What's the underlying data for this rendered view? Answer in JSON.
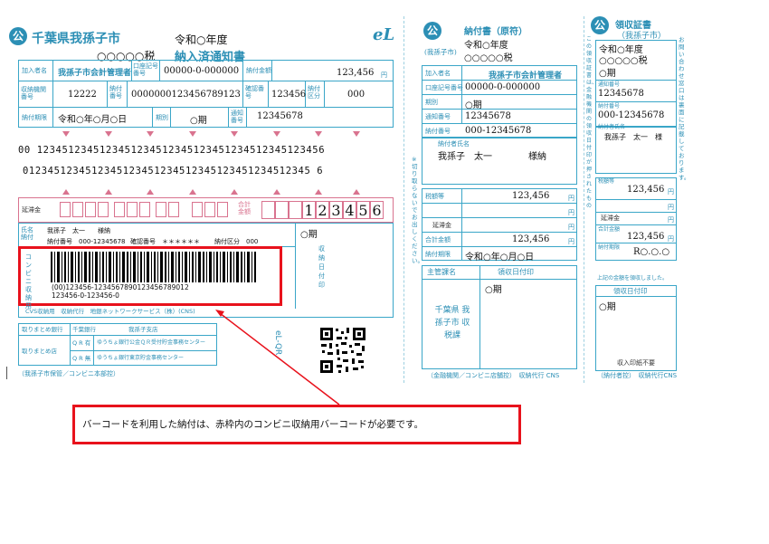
{
  "main": {
    "city": "千葉県我孫子市",
    "year": "令和○年度",
    "tax_name": "○○○○○税",
    "doc_title": "納入済通知書",
    "payer_label": "加入者名",
    "payer_value": "我孫子市会計管理者",
    "account_label": "口座記号番号",
    "account_value": "00000-0-000000",
    "amount_label": "納付金額",
    "amount_value": "123,456",
    "yen": "円",
    "inst_label": "収納機関番号",
    "inst_value": "12222",
    "notice_label": "納付番号",
    "notice_value": "0000000123456789123",
    "confirm_label": "確認番号",
    "confirm_value": "123456",
    "cls_label": "納付区分",
    "cls_value": "000",
    "due_label": "納付期限",
    "due_value": "令和○年○月○日",
    "period_label": "期別",
    "period_value": "○期",
    "notif_label": "通知番号",
    "notif_value": "12345678",
    "ocr_row1": "00 1234512345123451234512345123451234512345123456",
    "ocr_row2": "0123451234512345123451234512345123451234512345 6",
    "delay_label": "延滞金",
    "total_label": "合計金額",
    "total_digits": [
      "1",
      "2",
      "3",
      "4",
      "5",
      "6"
    ],
    "payer_small_label": "氏名納付",
    "payer_small_name": "我孫子　太一　　様納",
    "payer_small_notice": "納付番号　000-12345678",
    "payer_small_confirm": "確認番号　＊＊＊＊＊＊",
    "payer_small_cls": "納付区分　000",
    "period_right": "○期",
    "receipt_date_label": "収納日付印",
    "conv_label": "コンビニ収納用",
    "barcode_line1": "(00)123456-1234567890123456789012",
    "barcode_line2": "123456-0-123456-0",
    "cvs_label": "CVS収納用　収納代行　地銀ネットワークサービス（株）(CNS)",
    "bank_row1_label": "取りまとめ銀行",
    "bank_row1_a": "千葉銀行",
    "bank_row1_b": "我孫子支店",
    "bank_row2_label": "取りまとめ店",
    "bank_row2_a": "Q R 有",
    "bank_row2_b": "ゆうちょ銀行公金ＱＲ受付貯金事務センター",
    "bank_row3_a": "Q R 無",
    "bank_row3_b": "ゆうちょ銀行東京貯金事務センター",
    "eLQR": "eL-QR",
    "footer": "（我孫子市保管／コンビニ本部控）",
    "el_logo": "eL"
  },
  "middle": {
    "title": "納付書（原符）",
    "city": "(我孫子市)",
    "year": "令和○年度",
    "tax_name": "○○○○○税",
    "payer_label": "加入者名",
    "payer_value": "我孫子市会計管理者",
    "account_label": "口座記号番号",
    "account_value": "00000-0-000000",
    "period_label": "期別",
    "period_value": "○期",
    "notif_label": "通知番号",
    "notif_value": "12345678",
    "notice_label": "納付番号",
    "notice_value": "000-12345678",
    "name_label": "納付者氏名",
    "name_value": "我孫子　太一　　　　様納",
    "side_note": "※切り取らないでお出しください。",
    "tax_label": "税額等",
    "tax_value": "123,456",
    "delay_label": "延滞金",
    "total_label": "合計金額",
    "total_value": "123,456",
    "due_label": "納付期限",
    "due_value": "令和○年○月○日",
    "dept_label": "主管課名",
    "receipt_label": "領収日付印",
    "dept_value": "千葉県 我孫子市 収税課",
    "receipt_value": "○期",
    "footer": "（金融機関／コンビニ店舗控）　収納代行 CNS"
  },
  "right": {
    "title": "領収証書",
    "city": "（我孫子市）",
    "year": "令和○年度",
    "tax_name": "○○○○○税",
    "period_value": "○期",
    "notif_label": "通知番号",
    "notif_value": "12345678",
    "notice_label": "納付番号",
    "notice_value": "000-12345678",
    "name_label": "納付者氏名",
    "name_value": "我孫子　太一　様",
    "side_note": "お問い合わせ窓口は裏面に記載しております。",
    "side_note2": "この領収証書は、金融機関の領収日付印が押されたもので、再発行いたしません。",
    "tax_label": "税額等",
    "tax_value": "123,456",
    "delay_label": "延滞金",
    "total_label": "合計金額",
    "total_value": "123,456",
    "due_label": "納付期限",
    "due_value": "R○.○.○",
    "received": "上記の金額を領収しました。",
    "receipt_label": "領収日付印",
    "receipt_value": "○期",
    "stamp_note": "収入印紙不要",
    "footer": "（納付者控）　収納代行CNS"
  },
  "callout": {
    "text": "バーコードを利用した納付は、赤枠内のコンビニ収納用バーコードが必要です。"
  },
  "colors": {
    "teal": "#2c8fb5",
    "pink": "#d9738f",
    "red": "#e8121c"
  }
}
